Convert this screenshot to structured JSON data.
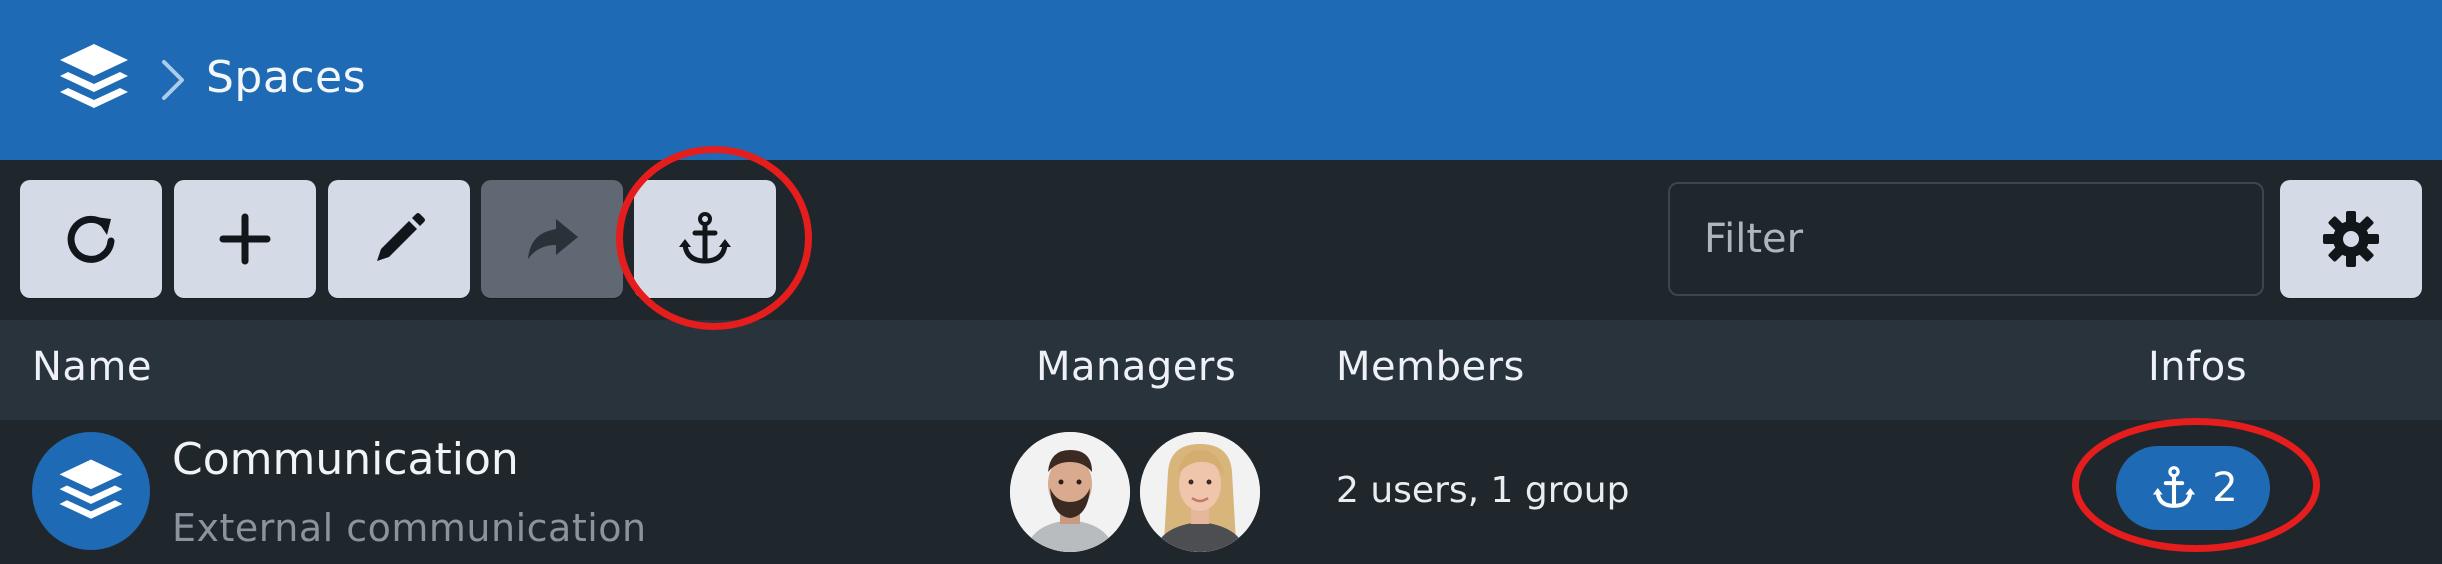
{
  "header": {
    "app_icon": "stacked-layers-icon",
    "breadcrumb_separator": "chevron-right-icon",
    "title": "Spaces",
    "background_color": "#1f6ab4"
  },
  "toolbar": {
    "buttons": [
      {
        "icon": "refresh-icon",
        "enabled": true
      },
      {
        "icon": "plus-icon",
        "enabled": true
      },
      {
        "icon": "pencil-icon",
        "enabled": true
      },
      {
        "icon": "share-arrow-icon",
        "enabled": false
      },
      {
        "icon": "anchor-icon",
        "enabled": true
      }
    ],
    "filter_placeholder": "Filter",
    "filter_value": "",
    "settings_icon": "gear-icon"
  },
  "table": {
    "columns": [
      "Name",
      "Managers",
      "Members",
      "Infos"
    ],
    "rows": [
      {
        "icon": "stacked-layers-icon",
        "name": "Communication",
        "description": "External communication",
        "managers": [
          "man-avatar",
          "woman-avatar"
        ],
        "members": "2 users, 1 group",
        "info_badge": {
          "icon": "anchor-icon",
          "count": "2"
        }
      }
    ]
  },
  "annotations": {
    "highlight_color": "#e51d1d"
  }
}
